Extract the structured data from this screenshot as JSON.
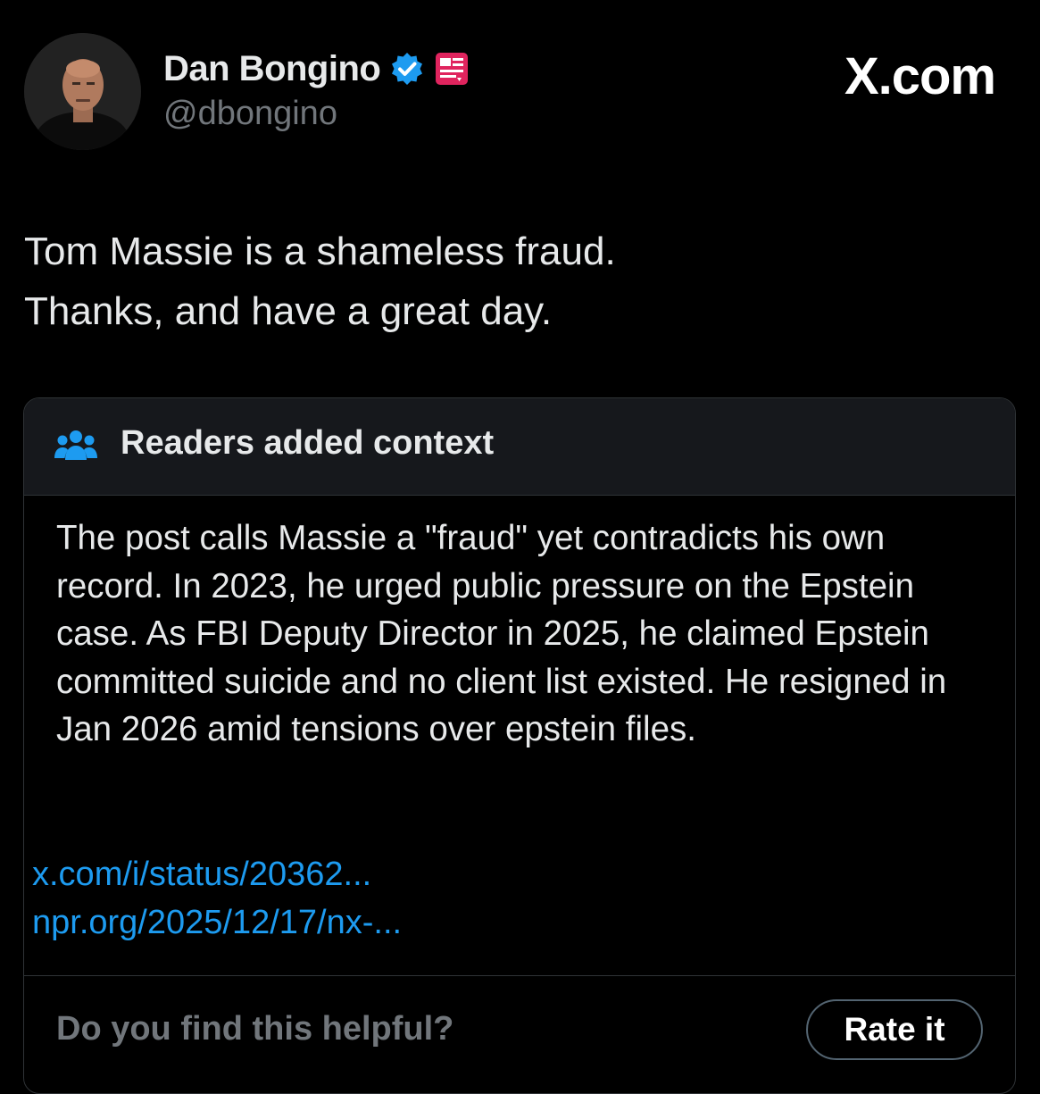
{
  "author": {
    "display_name": "Dan Bongino",
    "handle": "@dbongino",
    "avatar_icon": "profile-photo",
    "verified_badge_color": "#1d9bf0",
    "affiliate_badge_color": "#e0245e"
  },
  "brand": {
    "label": "X.com"
  },
  "post": {
    "text": "Tom Massie is a shameless fraud.\nThanks, and have a great day."
  },
  "community_note": {
    "header_icon": "people-icon",
    "title": "Readers added context",
    "body": "The post calls Massie a \"fraud\" yet contradicts his own record. In 2023, he urged public pressure on the Epstein case. As FBI Deputy Director in 2025, he claimed Epstein committed suicide and no client list existed. He resigned in Jan 2026 amid tensions over epstein files.",
    "links": [
      "x.com/i/status/20362...",
      "npr.org/2025/12/17/nx-..."
    ],
    "helpful_prompt": "Do you find this helpful?",
    "rate_button_label": "Rate it",
    "link_color": "#1d9bf0"
  }
}
